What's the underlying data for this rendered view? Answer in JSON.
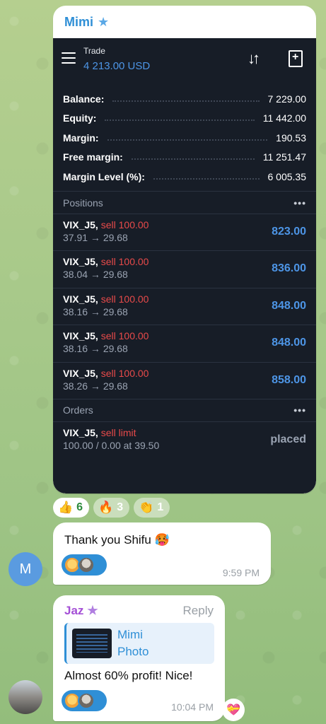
{
  "photo_message": {
    "sender": "Mimi",
    "sender_star": "★",
    "app": {
      "title": "Trade",
      "amount": "4 213.00 USD",
      "account": [
        {
          "label": "Balance:",
          "value": "7 229.00"
        },
        {
          "label": "Equity:",
          "value": "11 442.00"
        },
        {
          "label": "Margin:",
          "value": "190.53"
        },
        {
          "label": "Free margin:",
          "value": "11 251.47"
        },
        {
          "label": "Margin Level (%):",
          "value": "6 005.35"
        }
      ],
      "positions_label": "Positions",
      "positions": [
        {
          "symbol": "VIX_J5,",
          "side": "sell 100.00",
          "prices": "37.91 → 29.68",
          "profit": "823.00"
        },
        {
          "symbol": "VIX_J5,",
          "side": "sell 100.00",
          "prices": "38.04 → 29.68",
          "profit": "836.00"
        },
        {
          "symbol": "VIX_J5,",
          "side": "sell 100.00",
          "prices": "38.16 → 29.68",
          "profit": "848.00"
        },
        {
          "symbol": "VIX_J5,",
          "side": "sell 100.00",
          "prices": "38.16 → 29.68",
          "profit": "848.00"
        },
        {
          "symbol": "VIX_J5,",
          "side": "sell 100.00",
          "prices": "38.26 → 29.68",
          "profit": "858.00"
        }
      ],
      "orders_label": "Orders",
      "order": {
        "symbol": "VIX_J5,",
        "side": "sell limit",
        "detail": "100.00 / 0.00 at 39.50",
        "status": "placed"
      },
      "more": "•••"
    },
    "reactions": [
      {
        "emoji": "👍",
        "count": "6"
      },
      {
        "emoji": "🔥",
        "count": "3"
      },
      {
        "emoji": "👏",
        "count": "1"
      }
    ]
  },
  "message1": {
    "avatar_letter": "M",
    "text": "Thank you Shifu 🥵",
    "time": "9:59 PM"
  },
  "message2": {
    "sender": "Jaz",
    "sender_star": "★",
    "reply_label": "Reply",
    "quote_name": "Mimi",
    "quote_sub": "Photo",
    "text": "Almost 60% profit! Nice!",
    "time": "10:04 PM",
    "side_reaction": "💝"
  },
  "colors": {
    "accent": "#2f8fd6",
    "sell": "#e84a4a",
    "profit": "#4d95e6",
    "app_bg": "#171d27"
  }
}
